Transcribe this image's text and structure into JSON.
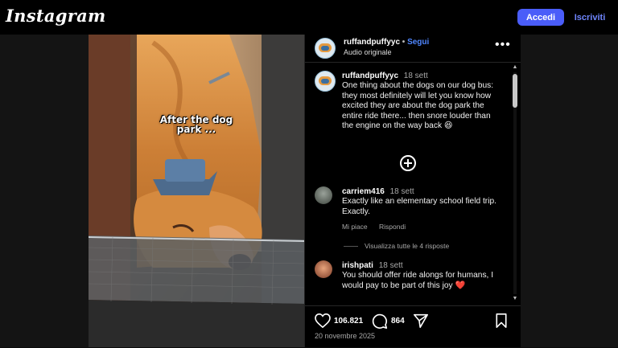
{
  "topbar": {
    "logo": "Instagram",
    "login_label": "Accedi",
    "signup_label": "Iscriviti"
  },
  "post": {
    "overlay_text": "After the dog park ...",
    "author": {
      "username": "ruffandpuffyyc",
      "separator": "•",
      "follow_label": "Segui",
      "audio_label": "Audio originale"
    },
    "caption": {
      "username": "ruffandpuffyyc",
      "time": "18 sett",
      "text": "One thing about the dogs on our dog bus: they most definitely will let you know how excited they are about the dog park the entire ride there... then snore louder than the engine on the way back 😆"
    },
    "comments": [
      {
        "username": "carriem416",
        "time": "18 sett",
        "text": "Exactly like an elementary school field trip. Exactly.",
        "like_label": "Mi piace",
        "reply_label": "Rispondi",
        "view_replies_label": "Visualizza tutte le 4 risposte"
      },
      {
        "username": "irishpati",
        "time": "18 sett",
        "text": "You should offer ride alongs for humans, I would pay to be part of this joy",
        "emoji": "❤️"
      }
    ],
    "stats": {
      "likes": "106.821",
      "comments": "864"
    },
    "date": "20 novembre 2025",
    "icons": {
      "more": "more-options-icon",
      "add": "add-comment-icon",
      "like": "heart-icon",
      "comment": "comment-icon",
      "share": "share-icon",
      "save": "bookmark-icon"
    }
  }
}
